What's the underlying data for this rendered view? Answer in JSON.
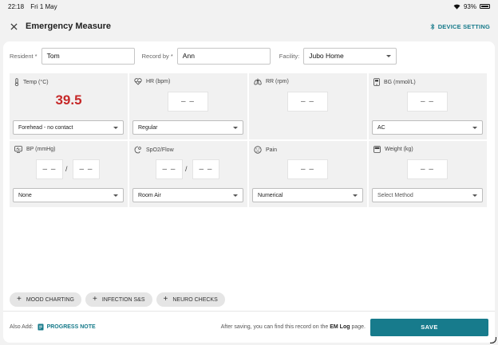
{
  "status_bar": {
    "time": "22:18",
    "date": "Fri 1 May",
    "battery": "93%"
  },
  "header": {
    "title": "Emergency Measure",
    "device_setting": "DEVICE SETTING"
  },
  "record": {
    "resident_label": "Resident *",
    "resident_value": "Tom",
    "record_by_label": "Record by *",
    "record_by_value": "Ann",
    "facility_label": "Facility:",
    "facility_value": "Jubo Home"
  },
  "vitals": {
    "temp": {
      "label": "Temp (°C)",
      "value": "39.5",
      "method": "Forehead - no contact"
    },
    "hr": {
      "label": "HR (bpm)",
      "value": "– –",
      "method": "Regular"
    },
    "rr": {
      "label": "RR (rpm)",
      "value": "– –"
    },
    "bg": {
      "label": "BG (mmol/L)",
      "value": "– –",
      "method": "AC"
    },
    "bp": {
      "label": "BP (mmHg)",
      "systolic": "– –",
      "diastolic": "– –",
      "separator": "/",
      "method": "None"
    },
    "spo2": {
      "label": "SpO2/Flow",
      "spo2": "– –",
      "flow": "– –",
      "separator": "/",
      "method": "Room Air"
    },
    "pain": {
      "label": "Pain",
      "value": "– –",
      "method": "Numerical"
    },
    "weight": {
      "label": "Weight (kg)",
      "value": "– –",
      "method": "Select Method"
    }
  },
  "chips": [
    {
      "label": "MOOD CHARTING"
    },
    {
      "label": "INFECTION S&S"
    },
    {
      "label": "NEURO CHECKS"
    }
  ],
  "footer": {
    "also_add": "Also Add:",
    "progress_note": "PROGRESS NOTE",
    "hint_prefix": "After saving, you can find this record on the",
    "hint_link": "EM Log",
    "hint_suffix": "page.",
    "save_label": "SAVE"
  },
  "colors": {
    "accent": "#177b8c",
    "alert": "#c62828"
  }
}
